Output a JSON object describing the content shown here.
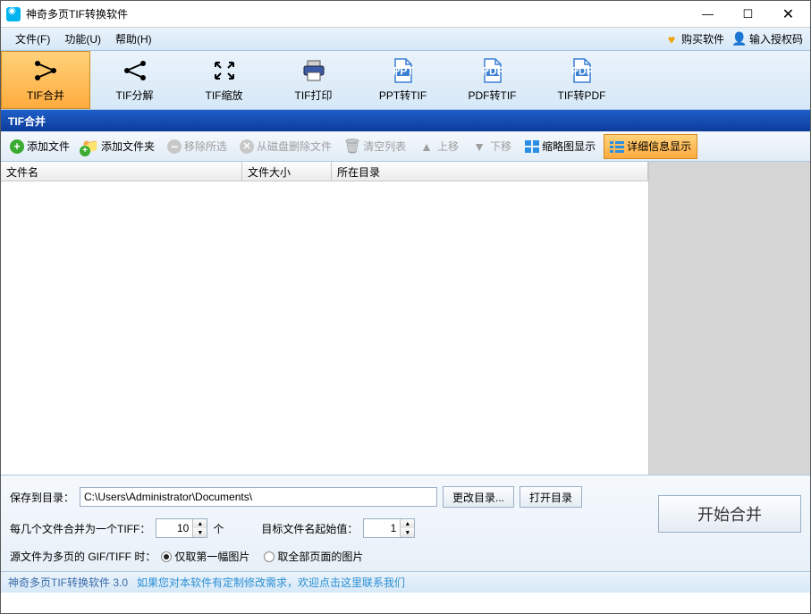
{
  "window": {
    "title": "神奇多页TIF转换软件"
  },
  "menu": {
    "file": "文件(F)",
    "function": "功能(U)",
    "help": "帮助(H)",
    "buy": "购买软件",
    "authcode": "输入授权码"
  },
  "bigtabs": {
    "merge": "TIF合并",
    "split": "TIF分解",
    "scale": "TIF缩放",
    "print": "TIF打印",
    "ppt": "PPT转TIF",
    "pdf": "PDF转TIF",
    "tifpdf": "TIF转PDF"
  },
  "section": {
    "title": "TIF合并"
  },
  "toolbar": {
    "addfile": "添加文件",
    "addfolder": "添加文件夹",
    "remove": "移除所选",
    "deletefromdisk": "从磁盘删除文件",
    "clear": "清空列表",
    "moveup": "上移",
    "movedown": "下移",
    "thumbview": "缩略图显示",
    "detailview": "详细信息显示"
  },
  "columns": {
    "name": "文件名",
    "size": "文件大小",
    "folder": "所在目录"
  },
  "bottom": {
    "savedir_label": "保存到目录：",
    "savedir_value": "C:\\Users\\Administrator\\Documents\\",
    "changedir": "更改目录...",
    "opendir": "打开目录",
    "perfile_prefix": "每几个文件合并为一个TIFF：",
    "perfile_value": "10",
    "perfile_unit": "个",
    "startname_label": "目标文件名起始值：",
    "startname_value": "1",
    "multipage_label": "源文件为多页的 GIF/TIFF 时：",
    "radio_first": "仅取第一幅图片",
    "radio_all": "取全部页面的图片",
    "start": "开始合并"
  },
  "status": {
    "version": "神奇多页TIF转换软件 3.0",
    "msg": "如果您对本软件有定制修改需求，欢迎点击这里联系我们"
  }
}
